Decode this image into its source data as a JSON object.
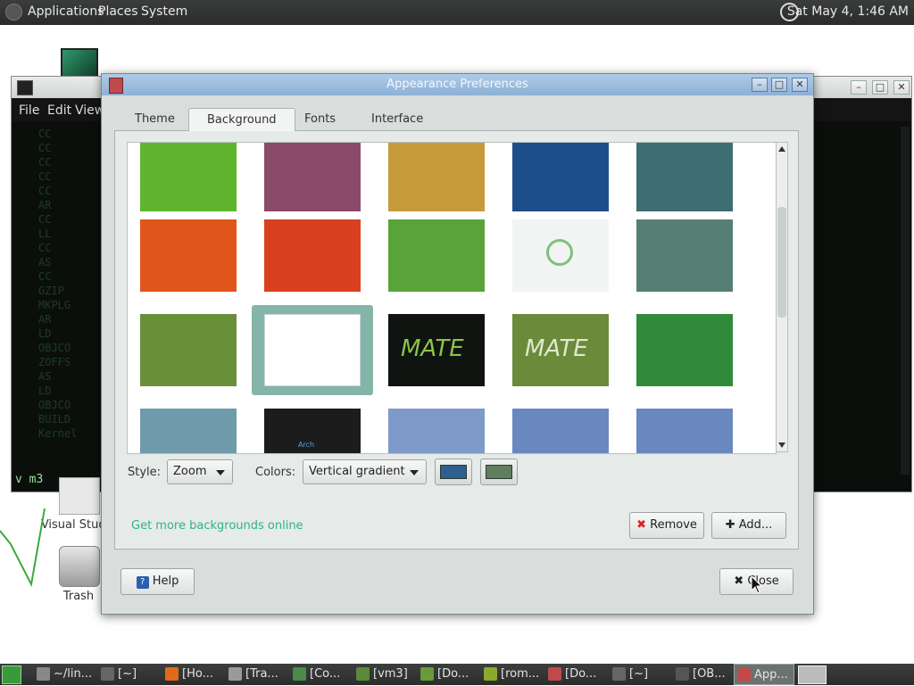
{
  "top_panel": {
    "menus": [
      "Applications",
      "Places",
      "System"
    ],
    "clock": "Sat May 4,  1:46 AM"
  },
  "desktop": {
    "icons": [
      {
        "label": "Visual Studio",
        "icon": "vscode-icon"
      },
      {
        "label": "Trash",
        "icon": "trash-icon"
      }
    ]
  },
  "terminal": {
    "menus": [
      "File",
      "Edit",
      "View"
    ],
    "rows": [
      "CC",
      "CC",
      "CC",
      "CC",
      "CC",
      "AR",
      "CC",
      "LL",
      "CC",
      "AS",
      "CC",
      "GZIP",
      "MKPLG",
      "AR",
      "LD",
      "OBJCO",
      "ZOFFS",
      "AS",
      "LD",
      "OBJCO",
      "BUILD",
      "Kernel"
    ],
    "status": "v m3"
  },
  "dialog": {
    "title": "Appearance Preferences",
    "tabs": [
      "Theme",
      "Background",
      "Fonts",
      "Interface"
    ],
    "active_tab": "Background",
    "style_label": "Style:",
    "style_value": "Zoom",
    "colors_label": "Colors:",
    "colors_value": "Vertical gradient",
    "color1": "#2e5f8f",
    "color2": "#5f7f5f",
    "link": "Get more backgrounds online",
    "remove_label": "Remove",
    "add_label": "Add...",
    "help_label": "Help",
    "close_label": "Close",
    "wallpapers": [
      {
        "name": "green-leaf",
        "bg": "#5fb52d"
      },
      {
        "name": "nebula",
        "bg": "#8a4a6a"
      },
      {
        "name": "wheat-field",
        "bg": "#c79a3a"
      },
      {
        "name": "blue-abstract",
        "bg": "#1e4e8a"
      },
      {
        "name": "teal-dots",
        "bg": "#3e6d73"
      },
      {
        "name": "orange-flower",
        "bg": "#e0561a"
      },
      {
        "name": "red-flower",
        "bg": "#d84020"
      },
      {
        "name": "grass",
        "bg": "#59a33a"
      },
      {
        "name": "mate-logo-light",
        "bg": "#f2f4f3"
      },
      {
        "name": "teal-wave",
        "bg": "#567f73"
      },
      {
        "name": "ladybug",
        "bg": "#6a8f3a"
      },
      {
        "name": "mate-sketch",
        "bg": "#ffffff"
      },
      {
        "name": "mate-dark",
        "bg": "#101410"
      },
      {
        "name": "mate-green",
        "bg": "#6b8a3a"
      },
      {
        "name": "green-leaves-dew",
        "bg": "#2f8a3a"
      },
      {
        "name": "blue-gradient",
        "bg": "#6f9aaa"
      },
      {
        "name": "arch-dark",
        "bg": "#1c1c1c"
      },
      {
        "name": "blue-flowers-1",
        "bg": "#7d9ac8"
      },
      {
        "name": "blue-flowers-2",
        "bg": "#6a88c0"
      },
      {
        "name": "blue-flowers-3",
        "bg": "#6a88c0"
      }
    ],
    "mate_text": "MATE",
    "arch_text": "Arch"
  },
  "taskbar": {
    "items": [
      {
        "label": "~/lin...",
        "color": "#888"
      },
      {
        "label": "[~]",
        "color": "#666"
      },
      {
        "label": "[Ho...",
        "color": "#e06a1a"
      },
      {
        "label": "[Tra...",
        "color": "#9a9a9a"
      },
      {
        "label": "[Co...",
        "color": "#4a8a4a"
      },
      {
        "label": "[vm3]",
        "color": "#5a8a3a"
      },
      {
        "label": "[Do...",
        "color": "#6a9a3a"
      },
      {
        "label": "[rom...",
        "color": "#8aaa2a"
      },
      {
        "label": "[Do...",
        "color": "#c04a4a"
      },
      {
        "label": "[~]",
        "color": "#666"
      },
      {
        "label": "[OB...",
        "color": "#555"
      },
      {
        "label": "App...",
        "color": "#c04a4a"
      }
    ]
  }
}
